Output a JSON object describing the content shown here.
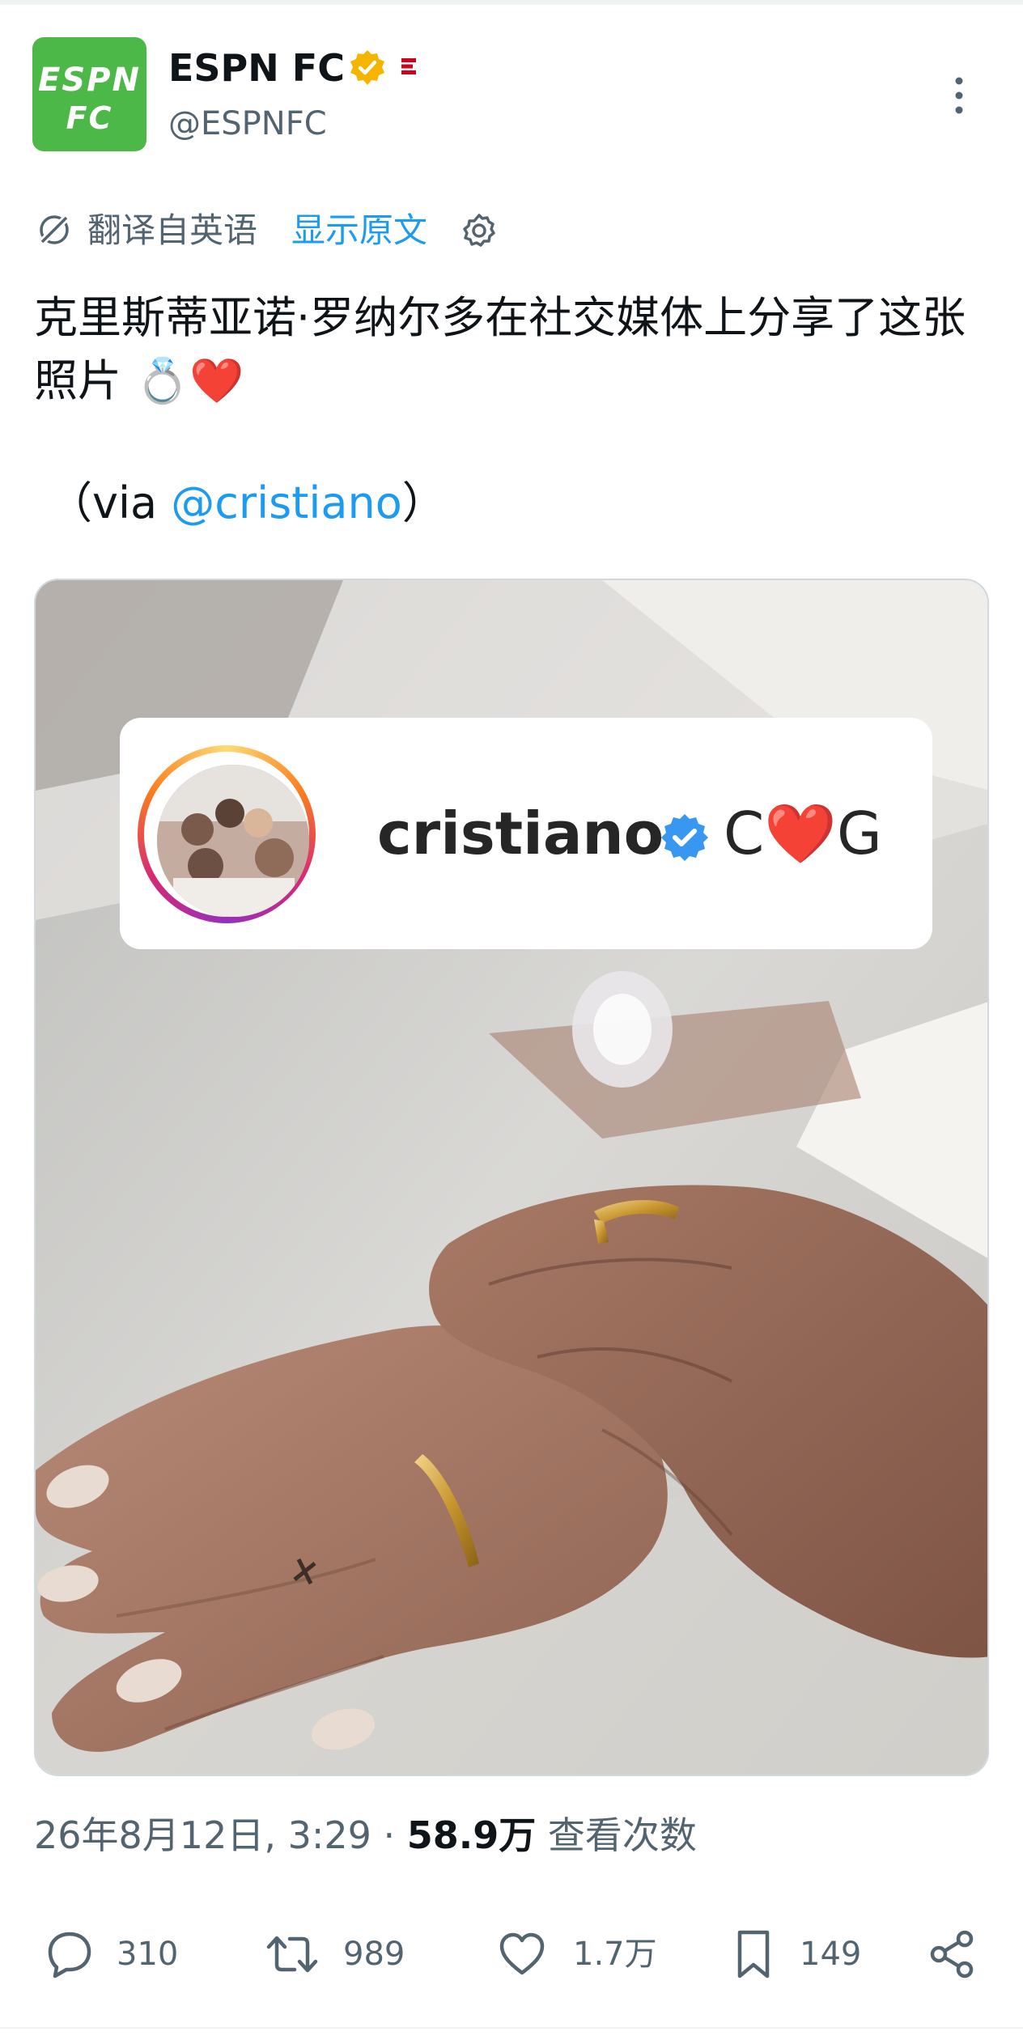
{
  "account": {
    "avatar_line1": "ESPN",
    "avatar_line2": "FC",
    "display_name": "ESPN FC",
    "handle": "@ESPNFC",
    "verified_badge": "gold-verified-icon",
    "affiliate_badge": "espn-affiliate-icon"
  },
  "translation": {
    "label": "翻译自英语",
    "show_original": "显示原文"
  },
  "tweet": {
    "text": "克里斯蒂亚诺·罗纳尔多在社交媒体上分享了这张照片 💍❤️",
    "via_prefix": "（via ",
    "via_mention": "@cristiano",
    "via_suffix": "）"
  },
  "media": {
    "ig_username": "cristiano",
    "ig_caption_c": "C",
    "ig_caption_heart": "❤️",
    "ig_caption_g": "G"
  },
  "meta": {
    "timestamp": "26年8月12日, 3:29",
    "separator": " · ",
    "views_count": "58.9万",
    "views_label": " 查看次数"
  },
  "actions": {
    "replies": "310",
    "retweets": "989",
    "likes": "1.7万",
    "bookmarks": "149"
  },
  "colors": {
    "accent": "#1d9bf0",
    "espn_green": "#4cb848",
    "secondary_text": "#536471",
    "gold_badge": "#f4b400"
  }
}
